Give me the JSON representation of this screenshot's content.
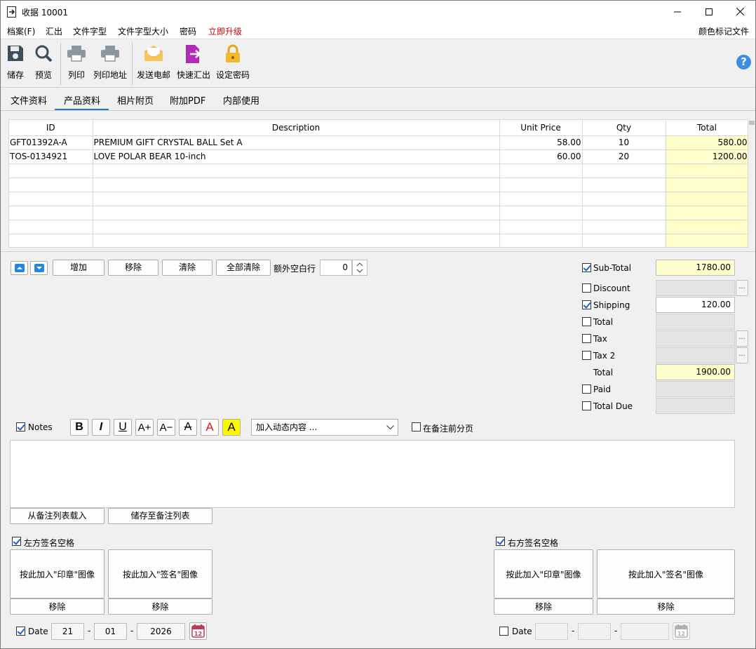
{
  "window": {
    "title": "收据 10001"
  },
  "menu": {
    "items": [
      "档案(F)",
      "汇出",
      "文件字型",
      "文件字型大小",
      "密码",
      "立即升级"
    ],
    "right_item": "颜色标记文件",
    "upgrade_color": "#e00000"
  },
  "toolbar": {
    "save": "储存",
    "preview": "预览",
    "print": "列印",
    "print_address": "列印地址",
    "send_email": "发送电邮",
    "quick_export": "快速汇出",
    "set_password": "设定密码"
  },
  "tabs": [
    "文件资料",
    "产品资料",
    "相片附页",
    "附加PDF",
    "内部使用"
  ],
  "active_tab": "产品资料",
  "grid": {
    "headers": [
      "ID",
      "Description",
      "Unit Price",
      "Qty",
      "Total"
    ],
    "rows": [
      [
        "GFT01392A-A",
        "PREMIUM GIFT CRYSTAL BALL Set A",
        "58.00",
        "10",
        "580.00"
      ],
      [
        "TOS-0134921",
        "LOVE POLAR BEAR 10-inch",
        "60.00",
        "20",
        "1200.00"
      ],
      [
        "",
        "",
        "",
        "",
        ""
      ],
      [
        "",
        "",
        "",
        "",
        ""
      ],
      [
        "",
        "",
        "",
        "",
        ""
      ],
      [
        "",
        "",
        "",
        "",
        ""
      ],
      [
        "",
        "",
        "",
        "",
        ""
      ],
      [
        "",
        "",
        "",
        "",
        ""
      ]
    ]
  },
  "row_actions": {
    "add": "增加",
    "remove": "移除",
    "clear": "清除",
    "clear_all": "全部清除",
    "extra_blank_label": "额外空白行",
    "extra_blank_value": "0"
  },
  "totals": {
    "subtotal_label": "Sub-Total",
    "subtotal_value": "1780.00",
    "discount_label": "Discount",
    "shipping_label": "Shipping",
    "shipping_value": "120.00",
    "total_chk_label": "Total",
    "tax_label": "Tax",
    "tax2_label": "Tax 2",
    "total_label": "Total",
    "total_value": "1900.00",
    "paid_label": "Paid",
    "total_due_label": "Total Due"
  },
  "notes": {
    "label": "Notes",
    "dynamic_placeholder": "加入动态内容 ...",
    "page_break_label": "在备注前分页",
    "load_from_list": "从备注列表载入",
    "save_to_list": "储存至备注列表",
    "fmt": {
      "bold": "B",
      "italic": "I",
      "underline": "U",
      "grow": "A+",
      "shrink": "A−",
      "strike": "A",
      "color": "A",
      "highlight": "A"
    }
  },
  "signature": {
    "left_label": "左方签名空格",
    "right_label": "右方签名空格",
    "stamp_btn": "按此加入\"印章\"图像",
    "sign_btn": "按此加入\"签名\"图像",
    "remove": "移除"
  },
  "date": {
    "label": "Date",
    "day": "21",
    "month": "01",
    "year": "2026",
    "sep": "-",
    "calendar_day": "12"
  }
}
